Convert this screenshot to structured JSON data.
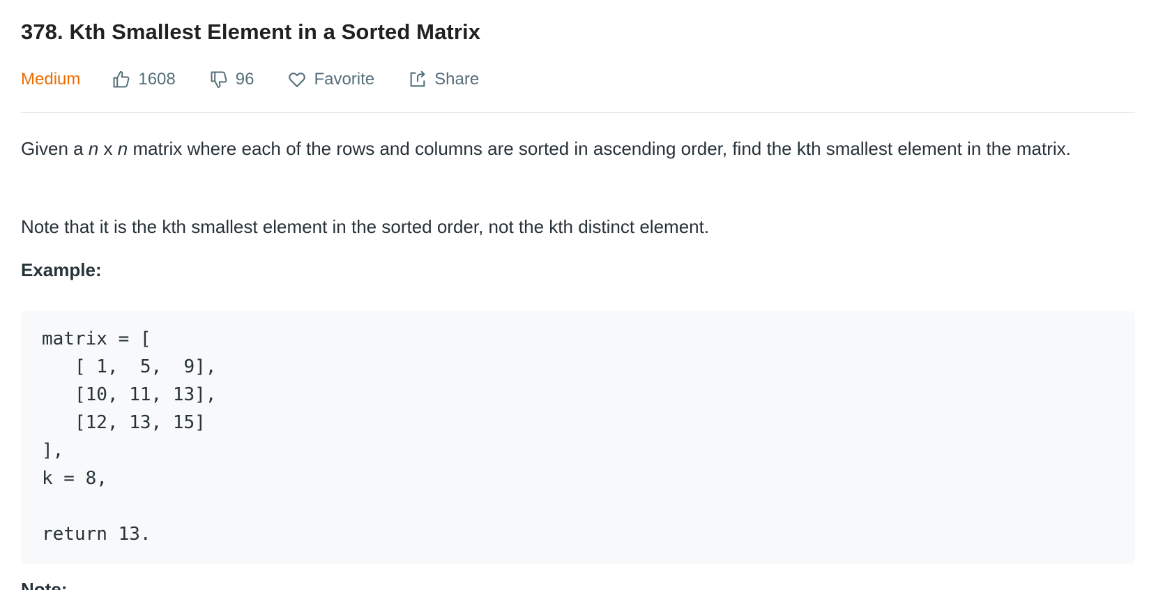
{
  "problem": {
    "title": "378. Kth Smallest Element in a Sorted Matrix",
    "difficulty": "Medium",
    "likes": "1608",
    "dislikes": "96",
    "favorite_label": "Favorite",
    "share_label": "Share"
  },
  "description": {
    "p1_before": "Given a ",
    "p1_n1": "n",
    "p1_x": " x ",
    "p1_n2": "n",
    "p1_after": " matrix where each of the rows and columns are sorted in ascending order, find the kth smallest element in the matrix.",
    "p2": "Note that it is the kth smallest element in the sorted order, not the kth distinct element.",
    "example_label": "Example:",
    "example_code": "matrix = [\n   [ 1,  5,  9],\n   [10, 11, 13],\n   [12, 13, 15]\n],\nk = 8,\n\nreturn 13.",
    "note_label": "Note:"
  },
  "colors": {
    "difficulty_medium": "#ef6c00",
    "meta_text": "#546e7a",
    "code_bg": "#f7f9fa"
  },
  "icons": {
    "like": "thumbs-up-icon",
    "dislike": "thumbs-down-icon",
    "favorite": "heart-icon",
    "share": "share-icon"
  }
}
